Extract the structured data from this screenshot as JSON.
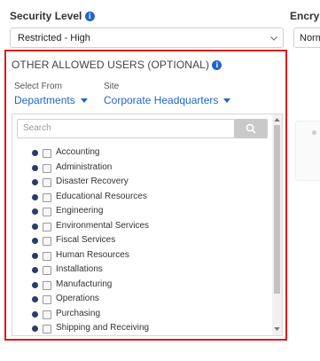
{
  "security_level": {
    "label": "Security Level",
    "value": "Restricted - High"
  },
  "encryption": {
    "label": "Encryp",
    "value": "Norm"
  },
  "other_users": {
    "title": "OTHER ALLOWED USERS (OPTIONAL)",
    "select_from_label": "Select From",
    "select_from_value": "Departments",
    "site_label": "Site",
    "site_value": "Corporate Headquarters",
    "search_placeholder": "Search",
    "items": [
      {
        "label": "Accounting"
      },
      {
        "label": "Administration"
      },
      {
        "label": "Disaster Recovery"
      },
      {
        "label": "Educational Resources"
      },
      {
        "label": "Engineering"
      },
      {
        "label": "Environmental Services"
      },
      {
        "label": "Fiscal Services"
      },
      {
        "label": "Human Resources"
      },
      {
        "label": "Installations"
      },
      {
        "label": "Manufacturing"
      },
      {
        "label": "Operations"
      },
      {
        "label": "Purchasing"
      },
      {
        "label": "Shipping and Receiving"
      }
    ]
  },
  "colors": {
    "accent": "#1f66c8",
    "highlight_frame": "#e01919",
    "bullet": "#2a3d6a"
  }
}
